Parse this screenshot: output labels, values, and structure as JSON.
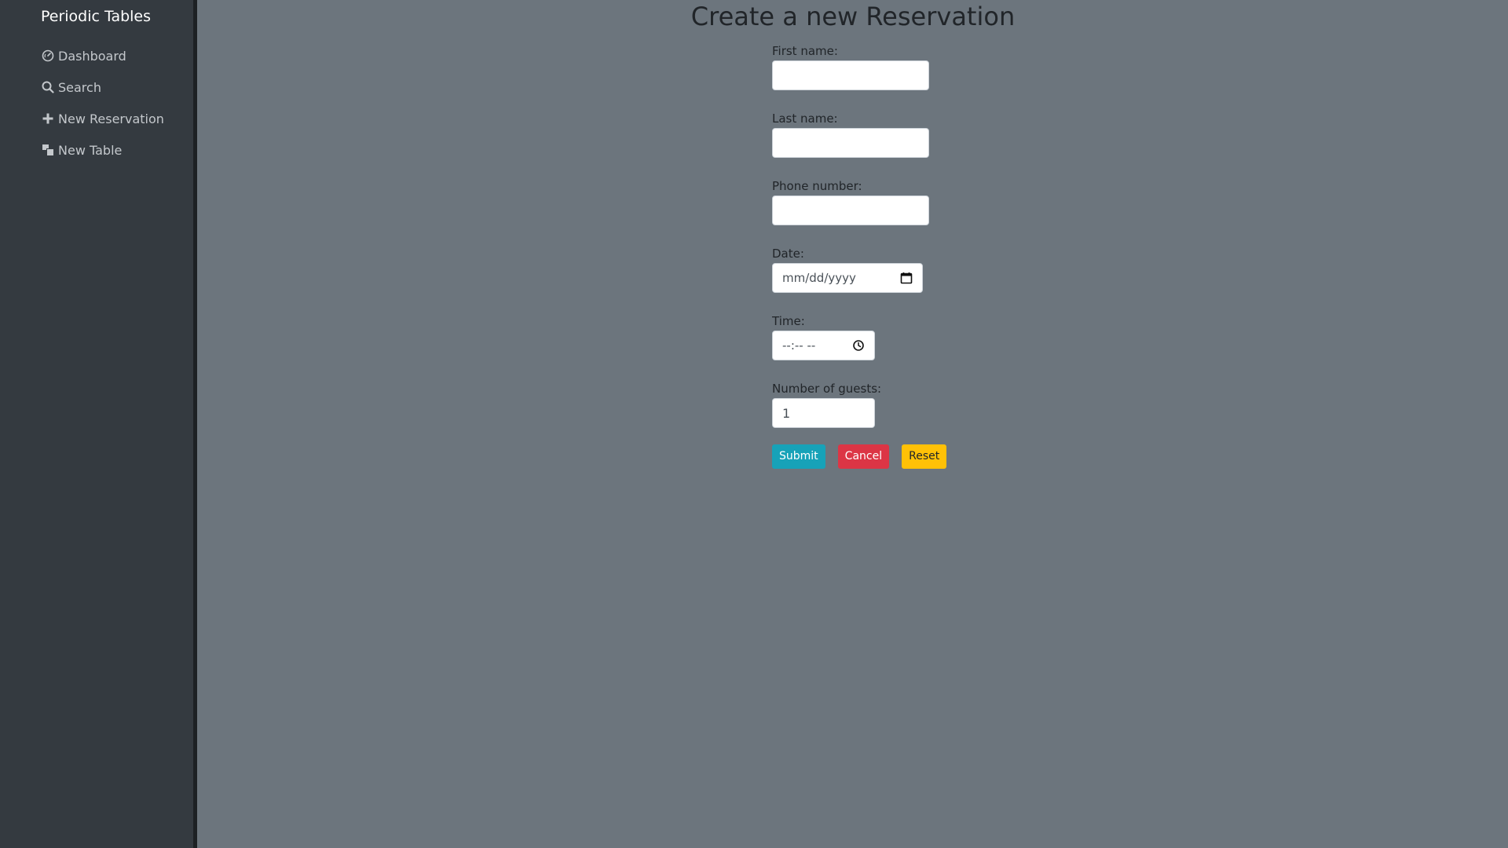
{
  "sidebar": {
    "brand": "Periodic Tables",
    "items": [
      {
        "label": "Dashboard",
        "icon": "dashboard-icon"
      },
      {
        "label": "Search",
        "icon": "search-icon"
      },
      {
        "label": "New Reservation",
        "icon": "plus-icon"
      },
      {
        "label": "New Table",
        "icon": "layers-icon"
      }
    ]
  },
  "main": {
    "title": "Create a new Reservation",
    "form": {
      "first_name_label": "First name:",
      "first_name_value": "",
      "last_name_label": "Last name:",
      "last_name_value": "",
      "phone_label": "Phone number:",
      "phone_value": "",
      "date_label": "Date:",
      "date_placeholder": "mm/dd/yyyy",
      "time_label": "Time:",
      "time_placeholder": "--:-- --",
      "guests_label": "Number of guests:",
      "guests_value": "1"
    },
    "buttons": {
      "submit": "Submit",
      "cancel": "Cancel",
      "reset": "Reset"
    }
  },
  "colors": {
    "sidebar_bg": "#343a40",
    "main_bg": "#6c757d",
    "submit": "#17a2b8",
    "cancel": "#dc3545",
    "reset": "#ffc107"
  }
}
